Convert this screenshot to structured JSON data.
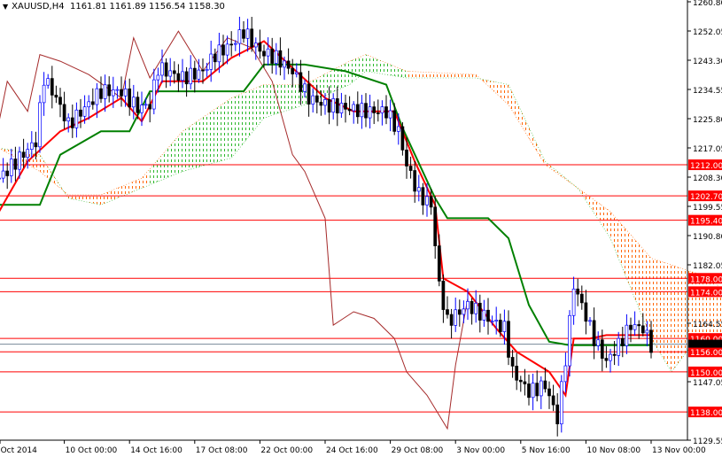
{
  "header": {
    "symbol": "XAUUSD,H4",
    "ohlc": "1161.81 1161.89 1156.54 1158.30"
  },
  "chart_data": {
    "type": "candlestick",
    "title": "XAUUSD,H4",
    "ylim": [
      1129.55,
      1260.8
    ],
    "y_ticks": [
      "1260.80",
      "1252.05",
      "1243.30",
      "1234.55",
      "1225.80",
      "1217.05",
      "1208.30",
      "1199.55",
      "1190.80",
      "1182.05",
      "1164.55",
      "1147.05",
      "1129.55"
    ],
    "x_ticks": [
      {
        "i": 0,
        "label": "7 Oct 2014"
      },
      {
        "i": 16,
        "label": "10 Oct 00:00"
      },
      {
        "i": 32,
        "label": "14 Oct 16:00"
      },
      {
        "i": 48,
        "label": "17 Oct 08:00"
      },
      {
        "i": 64,
        "label": "22 Oct 00:00"
      },
      {
        "i": 80,
        "label": "24 Oct 16:00"
      },
      {
        "i": 96,
        "label": "29 Oct 08:00"
      },
      {
        "i": 112,
        "label": "3 Nov 00:00"
      },
      {
        "i": 128,
        "label": "5 Nov 16:00"
      },
      {
        "i": 144,
        "label": "10 Nov 08:00"
      },
      {
        "i": 160,
        "label": "13 Nov 00:00"
      }
    ],
    "close_anchors": [
      [
        0,
        1208
      ],
      [
        5,
        1214
      ],
      [
        9,
        1219
      ],
      [
        11,
        1238
      ],
      [
        14,
        1232
      ],
      [
        17,
        1224
      ],
      [
        21,
        1229
      ],
      [
        25,
        1234
      ],
      [
        30,
        1234
      ],
      [
        34,
        1229
      ],
      [
        37,
        1230
      ],
      [
        39,
        1241
      ],
      [
        45,
        1238
      ],
      [
        50,
        1240
      ],
      [
        53,
        1245
      ],
      [
        57,
        1248
      ],
      [
        60,
        1252
      ],
      [
        64,
        1246
      ],
      [
        68,
        1244
      ],
      [
        72,
        1240
      ],
      [
        76,
        1232
      ],
      [
        80,
        1230
      ],
      [
        85,
        1229
      ],
      [
        90,
        1228
      ],
      [
        95,
        1228
      ],
      [
        98,
        1222
      ],
      [
        100,
        1212
      ],
      [
        103,
        1203
      ],
      [
        106,
        1200
      ],
      [
        108,
        1176
      ],
      [
        110,
        1165
      ],
      [
        115,
        1170
      ],
      [
        120,
        1166
      ],
      [
        124,
        1163
      ],
      [
        126,
        1150
      ],
      [
        130,
        1144
      ],
      [
        134,
        1146
      ],
      [
        137,
        1136
      ],
      [
        139,
        1154
      ],
      [
        141,
        1176
      ],
      [
        143,
        1170
      ],
      [
        146,
        1160
      ],
      [
        149,
        1153
      ],
      [
        152,
        1158
      ],
      [
        155,
        1164
      ],
      [
        158,
        1163
      ],
      [
        160,
        1158
      ]
    ],
    "current_price": 1158.3,
    "tenkan": [
      [
        0,
        1198
      ],
      [
        7,
        1213
      ],
      [
        15,
        1222
      ],
      [
        22,
        1226
      ],
      [
        30,
        1232
      ],
      [
        35,
        1225
      ],
      [
        40,
        1237
      ],
      [
        50,
        1237
      ],
      [
        57,
        1244
      ],
      [
        65,
        1249
      ],
      [
        72,
        1241
      ],
      [
        80,
        1232
      ],
      [
        87,
        1228
      ],
      [
        97,
        1228
      ],
      [
        102,
        1213
      ],
      [
        107,
        1200
      ],
      [
        109,
        1178
      ],
      [
        115,
        1174
      ],
      [
        122,
        1163
      ],
      [
        127,
        1156
      ],
      [
        135,
        1150
      ],
      [
        139,
        1143
      ],
      [
        141,
        1160
      ],
      [
        145,
        1160
      ],
      [
        149,
        1161
      ],
      [
        152,
        1161
      ],
      [
        160,
        1161
      ]
    ],
    "kijun": [
      [
        0,
        1200
      ],
      [
        10,
        1200
      ],
      [
        15,
        1215
      ],
      [
        25,
        1222
      ],
      [
        32,
        1222
      ],
      [
        37,
        1234
      ],
      [
        60,
        1234
      ],
      [
        65,
        1242
      ],
      [
        75,
        1242
      ],
      [
        85,
        1240
      ],
      [
        95,
        1236
      ],
      [
        99,
        1223
      ],
      [
        107,
        1202
      ],
      [
        110,
        1196
      ],
      [
        120,
        1196
      ],
      [
        125,
        1190
      ],
      [
        130,
        1170
      ],
      [
        135,
        1159
      ],
      [
        140,
        1158
      ],
      [
        150,
        1158
      ],
      [
        160,
        1158
      ]
    ],
    "chikou": [
      [
        0,
        1225
      ],
      [
        2,
        1237
      ],
      [
        7,
        1228
      ],
      [
        10,
        1245
      ],
      [
        15,
        1243
      ],
      [
        22,
        1239
      ],
      [
        30,
        1232
      ],
      [
        33,
        1250
      ],
      [
        37,
        1238
      ],
      [
        44,
        1252
      ],
      [
        50,
        1240
      ],
      [
        56,
        1250
      ],
      [
        62,
        1247
      ],
      [
        67,
        1237
      ],
      [
        72,
        1215
      ],
      [
        75,
        1210
      ],
      [
        80,
        1196
      ],
      [
        82,
        1164
      ],
      [
        87,
        1168
      ],
      [
        92,
        1166
      ],
      [
        97,
        1160
      ],
      [
        100,
        1150
      ],
      [
        105,
        1143
      ],
      [
        110,
        1133
      ],
      [
        112,
        1152
      ],
      [
        115,
        1172
      ]
    ],
    "span_a": [
      [
        0,
        1217
      ],
      [
        10,
        1210
      ],
      [
        17,
        1203
      ],
      [
        25,
        1203
      ],
      [
        35,
        1208
      ],
      [
        45,
        1222
      ],
      [
        57,
        1232
      ],
      [
        65,
        1236
      ],
      [
        75,
        1236
      ],
      [
        86,
        1243
      ],
      [
        90,
        1245
      ],
      [
        100,
        1240
      ],
      [
        117,
        1239
      ],
      [
        125,
        1230
      ],
      [
        134,
        1212
      ],
      [
        142,
        1205
      ],
      [
        150,
        1198
      ],
      [
        160,
        1184
      ],
      [
        175,
        1178
      ],
      [
        180,
        1170
      ],
      [
        185,
        1163
      ]
    ],
    "span_b": [
      [
        0,
        1217
      ],
      [
        10,
        1215
      ],
      [
        17,
        1202
      ],
      [
        25,
        1200
      ],
      [
        35,
        1205
      ],
      [
        45,
        1210
      ],
      [
        57,
        1214
      ],
      [
        65,
        1226
      ],
      [
        75,
        1230
      ],
      [
        86,
        1236
      ],
      [
        90,
        1240
      ],
      [
        100,
        1238
      ],
      [
        117,
        1238
      ],
      [
        125,
        1236
      ],
      [
        134,
        1213
      ],
      [
        142,
        1205
      ],
      [
        150,
        1190
      ],
      [
        160,
        1160
      ],
      [
        165,
        1150
      ],
      [
        170,
        1158
      ],
      [
        175,
        1160
      ],
      [
        185,
        1157
      ]
    ],
    "levels": [
      1212.0,
      1202.7,
      1195.4,
      1178.0,
      1174.0,
      1160.0,
      1156.0,
      1150.0,
      1138.0
    ],
    "level_labels": [
      "1212.00",
      "1202.70",
      "1195.40",
      "1178.00",
      "1174.00",
      "1160.00",
      "1156.00",
      "1150.00",
      "1138.00"
    ],
    "colors": {
      "level": "#ff0000",
      "tenkan": "#ff0000",
      "kijun": "#008000",
      "chikou": "#a52a2a",
      "bull": "#0000ff",
      "bear": "#000000",
      "cloud_up": "#2db82d",
      "cloud_down": "#ff6600"
    }
  }
}
